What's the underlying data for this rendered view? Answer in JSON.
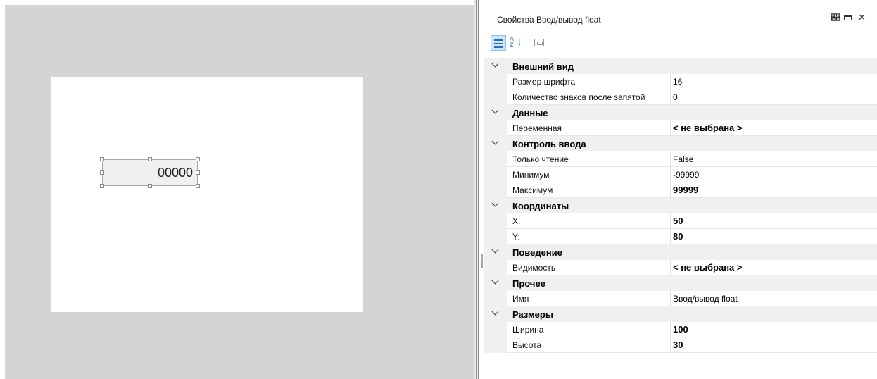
{
  "designer": {
    "widget_value": "00000"
  },
  "properties": {
    "title": "Свойства Ввод/вывод float",
    "icons": {
      "pin": "pin-icon",
      "maximize": "maximize-icon",
      "close": "close-icon",
      "categorized": "categorized-view-icon",
      "alphabetical": "alphabetical-sort-icon",
      "pages": "property-pages-icon"
    },
    "categories": [
      {
        "label": "Внешний вид",
        "items": [
          {
            "name": "Размер шрифта",
            "value": "16",
            "bold": false
          },
          {
            "name": "Количество знаков после запятой",
            "value": "0",
            "bold": false
          }
        ]
      },
      {
        "label": "Данные",
        "items": [
          {
            "name": "Переменная",
            "value": "< не выбрана >",
            "bold": true
          }
        ]
      },
      {
        "label": "Контроль ввода",
        "items": [
          {
            "name": "Только чтение",
            "value": "False",
            "bold": false
          },
          {
            "name": "Минимум",
            "value": "-99999",
            "bold": false
          },
          {
            "name": "Максимум",
            "value": "99999",
            "bold": true
          }
        ]
      },
      {
        "label": "Координаты",
        "items": [
          {
            "name": "X:",
            "value": "50",
            "bold": true
          },
          {
            "name": "Y:",
            "value": "80",
            "bold": true
          }
        ]
      },
      {
        "label": "Поведение",
        "items": [
          {
            "name": "Видимость",
            "value": "< не выбрана >",
            "bold": true
          }
        ]
      },
      {
        "label": "Прочее",
        "items": [
          {
            "name": "Имя",
            "value": "Ввод/вывод float",
            "bold": false
          }
        ]
      },
      {
        "label": "Размеры",
        "items": [
          {
            "name": "Ширина",
            "value": "100",
            "bold": true
          },
          {
            "name": "Высота",
            "value": "30",
            "bold": true
          }
        ]
      }
    ]
  }
}
